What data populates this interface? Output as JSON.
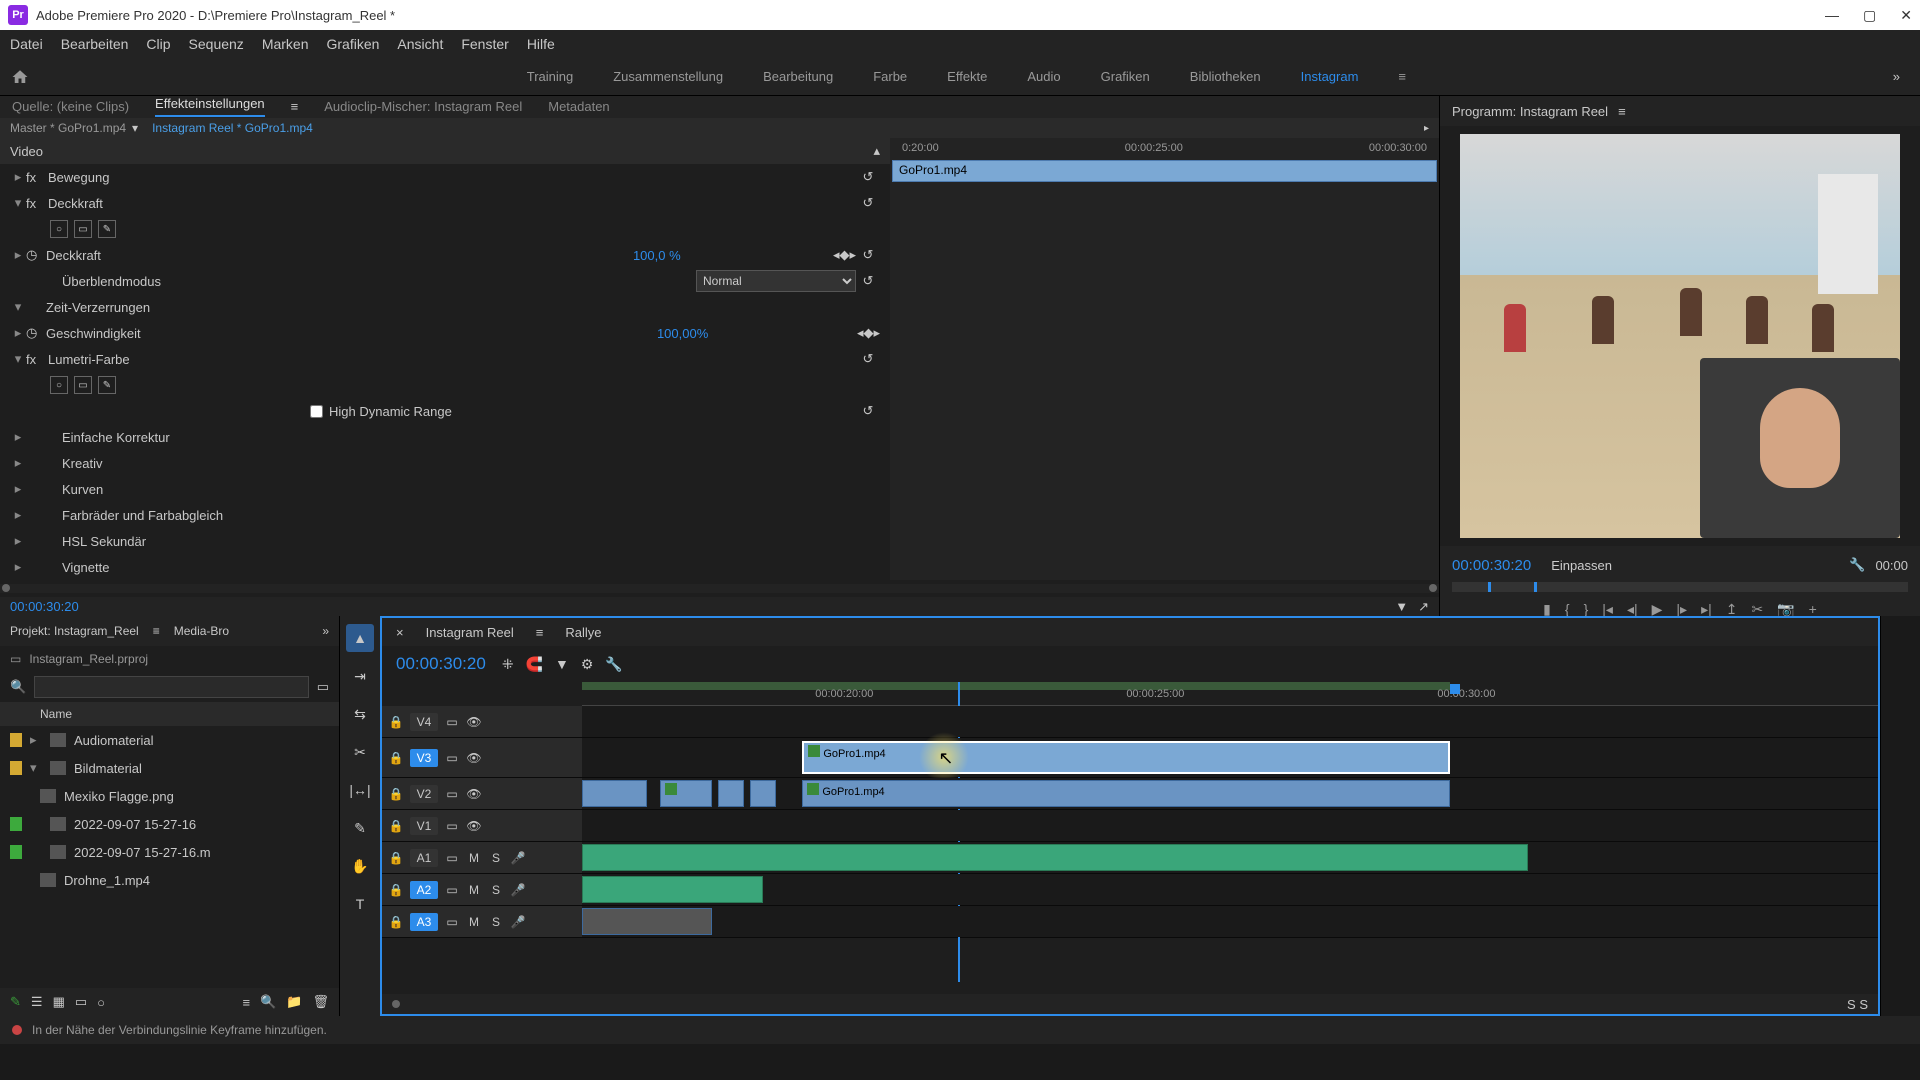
{
  "titlebar": {
    "app": "Adobe Premiere Pro 2020",
    "path": "D:\\Premiere Pro\\Instagram_Reel *",
    "minimize": "—",
    "maximize": "▢",
    "close": "✕"
  },
  "menubar": [
    "Datei",
    "Bearbeiten",
    "Clip",
    "Sequenz",
    "Marken",
    "Grafiken",
    "Ansicht",
    "Fenster",
    "Hilfe"
  ],
  "workspaces": {
    "items": [
      "Training",
      "Zusammenstellung",
      "Bearbeitung",
      "Farbe",
      "Effekte",
      "Audio",
      "Grafiken",
      "Bibliotheken",
      "Instagram"
    ],
    "active": "Instagram",
    "overflow": "»"
  },
  "effect_tabs": {
    "source": "Quelle: (keine Clips)",
    "effects": "Effekteinstellungen",
    "audio_mixer": "Audioclip-Mischer: Instagram Reel",
    "metadata": "Metadaten"
  },
  "effect_header": {
    "master": "Master * GoPro1.mp4",
    "sequence": "Instagram Reel * GoPro1.mp4",
    "ruler": [
      "0:20:00",
      "00:00:25:00",
      "00:00:30:00"
    ],
    "clip_name": "GoPro1.mp4"
  },
  "props": {
    "video_section": "Video",
    "motion": "Bewegung",
    "opacity": "Deckkraft",
    "opacity_prop": "Deckkraft",
    "opacity_val": "100,0 %",
    "blend": "Überblendmodus",
    "blend_val": "Normal",
    "time": "Zeit-Verzerrungen",
    "speed": "Geschwindigkeit",
    "speed_val": "100,00%",
    "lumetri": "Lumetri-Farbe",
    "hdr": "High Dynamic Range",
    "basic": "Einfache Korrektur",
    "creative": "Kreativ",
    "curves": "Kurven",
    "wheels": "Farbräder und Farbabgleich",
    "hsl": "HSL Sekundär",
    "vignette": "Vignette"
  },
  "effect_footer": {
    "tc": "00:00:30:20"
  },
  "program": {
    "title": "Programm: Instagram Reel",
    "tc": "00:00:30:20",
    "zoom": "Einpassen",
    "tc2": "00:00"
  },
  "project": {
    "tab1": "Projekt: Instagram_Reel",
    "tab2": "Media-Bro",
    "chev": "»",
    "filename": "Instagram_Reel.prproj",
    "col_name": "Name",
    "items": [
      {
        "color": "orange",
        "expand": "▸",
        "type": "folder",
        "name": "Audiomaterial"
      },
      {
        "color": "orange",
        "expand": "▾",
        "type": "folder",
        "name": "Bildmaterial"
      },
      {
        "color": "",
        "expand": "",
        "type": "image",
        "name": "Mexiko Flagge.png",
        "indent": true
      },
      {
        "color": "green",
        "expand": "",
        "type": "seq",
        "name": "2022-09-07 15-27-16"
      },
      {
        "color": "green",
        "expand": "",
        "type": "clip",
        "name": "2022-09-07 15-27-16.m"
      },
      {
        "color": "",
        "expand": "",
        "type": "clip",
        "name": "Drohne_1.mp4",
        "indent": true
      }
    ]
  },
  "timeline": {
    "tab1": "Instagram Reel",
    "tab2": "Rallye",
    "tc": "00:00:30:20",
    "ruler": [
      "00:00:20:00",
      "00:00:25:00",
      "00:00:30:00"
    ],
    "tracks": {
      "v4": "V4",
      "v3": "V3",
      "v2": "V2",
      "v1": "V1",
      "a1": "A1",
      "a2": "A2",
      "a3": "A3"
    },
    "mute": "M",
    "solo": "S",
    "rec": "●",
    "clips": {
      "v3": "GoPro1.mp4",
      "v2": "GoPro1.mp4"
    },
    "scale_label": "S  S"
  },
  "statusbar": {
    "text": "In der Nähe der Verbindungslinie Keyframe hinzufügen."
  }
}
